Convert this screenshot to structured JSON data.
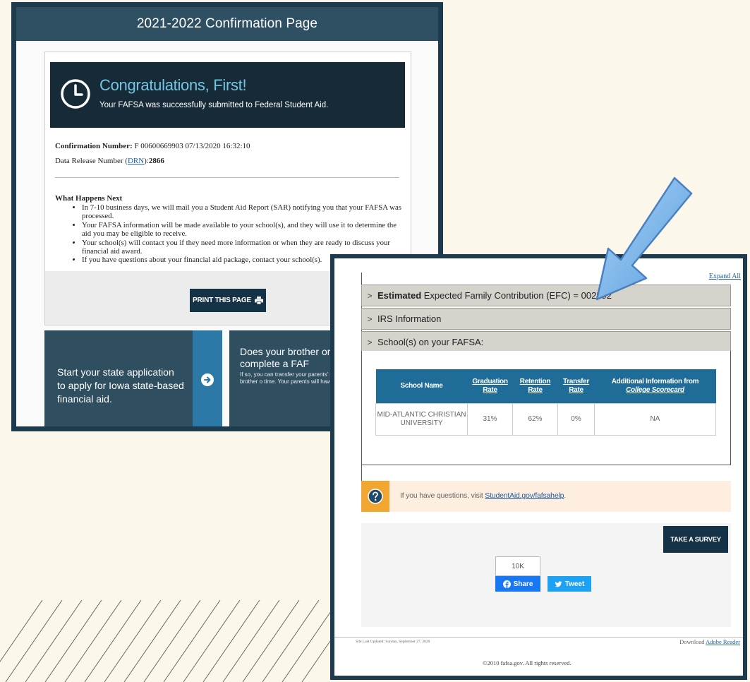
{
  "colors": {
    "background": "#fbf7ea",
    "navy": "#1e3a4f",
    "header_dark": "#172a37",
    "congrats_accent": "#72c6e3",
    "table_header": "#1f6c99",
    "help_orange": "#f0a630",
    "arrow_blue": "#6aaee8"
  },
  "confirmation": {
    "window_title": "2021-2022 Confirmation Page",
    "congrats_title": "Congratulations, First!",
    "congrats_subtitle": "Your FAFSA was successfully submitted to Federal Student Aid.",
    "confirmation_label": "Confirmation Number:",
    "confirmation_value": "F 00600669903 07/13/2020 16:32:10",
    "drn_label_prefix": "Data Release Number (",
    "drn_link": "DRN",
    "drn_label_suffix": "):",
    "drn_value": "2866",
    "next_heading": "What Happens Next",
    "next_items": [
      "In 7-10 business days, we will mail you a Student Aid Report (SAR) notifying you that your FAFSA was processed.",
      "Your FAFSA information will be made available to your school(s), and they will use it to determine the aid you may be eligible to receive.",
      "Your school(s) will contact you if they need more information or when they are ready to discuss your financial aid award.",
      "If you have questions about your financial aid package, contact your school(s)."
    ],
    "print_label": "PRINT THIS PAGE",
    "state_text": "Start your state application to apply for Iowa state-based financial aid.",
    "brother_title": "Does your brother or sis need to complete a FAF",
    "brother_body": "If so, you can transfer your parents' into a new FAFSA for your brother o time. Your parents will have to provi again, but that's all."
  },
  "summary": {
    "expand_all": "Expand All",
    "efc_bold": "Estimated",
    "efc_rest": " Expected Family Contribution (EFC) = 002592",
    "irs_label": "IRS Information",
    "schools_label": "School(s) on your FAFSA:",
    "table_headers": {
      "school_name": "School Name",
      "graduation": "Graduation Rate",
      "retention": "Retention Rate",
      "transfer": "Transfer Rate",
      "additional_line1": "Additional Information from",
      "additional_line2": "College Scorecard"
    },
    "rows": [
      {
        "school": "MID-ATLANTIC CHRISTIAN UNIVERSITY",
        "graduation": "31%",
        "retention": "62%",
        "transfer": "0%",
        "additional": "NA"
      }
    ],
    "help_prefix": "If you have questions, visit ",
    "help_link": "StudentAid.gov/fafsahelp",
    "help_suffix": ".",
    "survey_label": "TAKE A SURVEY",
    "share_count": "10K",
    "share_label": "Share",
    "tweet_label": "Tweet",
    "footer_updated": "Site Last Updated: Sunday, September 27, 2020",
    "footer_download_prefix": "Download ",
    "footer_download_link": "Adobe Reader",
    "footer_copyright": "©2010 fafsa.gov. All rights reserved."
  },
  "icons": {
    "clock": "clock-icon",
    "printer": "printer-icon",
    "arrow": "arrow-circle-icon",
    "help": "question-icon",
    "facebook": "facebook-icon",
    "twitter": "twitter-icon"
  }
}
